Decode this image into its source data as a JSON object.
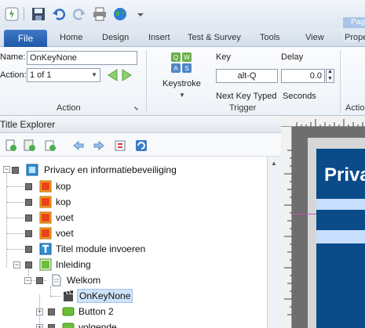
{
  "quick_access": {
    "icons": [
      "app-logo-icon",
      "save-icon",
      "undo-icon",
      "redo-icon",
      "print-icon",
      "publish-globe-icon",
      "customize-dropdown-icon"
    ]
  },
  "tabs": {
    "file": "File",
    "items": [
      "Home",
      "Design",
      "Insert",
      "Test & Survey",
      "Tools",
      "View"
    ],
    "context_group": "Pag",
    "context_tab": "Prope"
  },
  "ribbon": {
    "action_group": {
      "name_label": "Name:",
      "name_value": "OnKeyNone",
      "action_label": "Action:",
      "action_value": "1 of 1",
      "group_label": "Action"
    },
    "trigger_group": {
      "keystroke_label": "Keystroke",
      "key_header": "Key",
      "key_value": "alt-Q",
      "delay_header": "Delay",
      "delay_value": "0.0",
      "next_key_typed": "Next Key Typed",
      "seconds": "Seconds",
      "group_label": "Trigger"
    },
    "cut_group_label": "Actio"
  },
  "panel": {
    "title": "Title Explorer",
    "toolbar_icons": [
      "add-page-icon",
      "add-chapter-icon",
      "add-section-icon",
      "move-left-icon",
      "move-right-icon",
      "move-up-down-icon",
      "refresh-icon"
    ]
  },
  "tree": [
    {
      "label": "Privacy en informatiebeveiliging",
      "icon": "title-book-icon",
      "level": 0
    },
    {
      "label": "kop",
      "icon": "image-icon",
      "level": 1
    },
    {
      "label": "kop",
      "icon": "image-icon",
      "level": 1
    },
    {
      "label": "voet",
      "icon": "image-icon",
      "level": 1
    },
    {
      "label": "voet",
      "icon": "image-icon",
      "level": 1
    },
    {
      "label": "Titel module invoeren",
      "icon": "text-icon",
      "level": 1
    },
    {
      "label": "Inleiding",
      "icon": "chapter-icon",
      "level": 1
    },
    {
      "label": "Welkom",
      "icon": "page-icon",
      "level": 2
    },
    {
      "label": "OnKeyNone",
      "icon": "action-clapper-icon",
      "level": 3,
      "selected": true
    },
    {
      "label": "Button 2",
      "icon": "button-icon",
      "level": 3
    },
    {
      "label": "volgende",
      "icon": "button-icon",
      "level": 3
    }
  ],
  "preview": {
    "slide_title": "Priva",
    "slide_color": "#0b4b8a",
    "band_color": "#c9defc"
  }
}
